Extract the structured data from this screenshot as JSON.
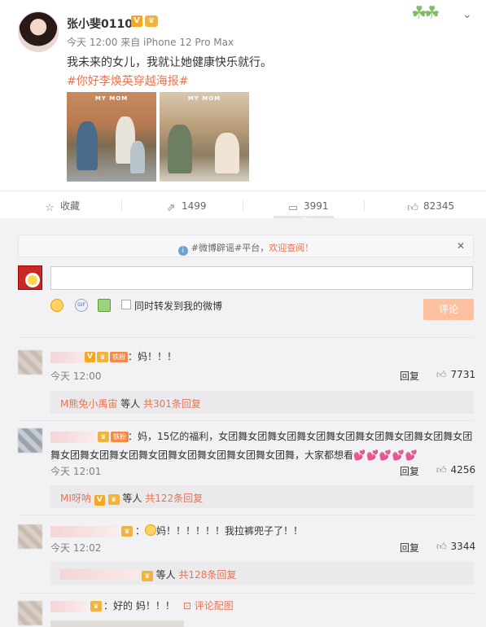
{
  "post": {
    "username": "张小斐0110",
    "meta": "今天 12:00 来自 iPhone 12 Pro Max",
    "text": "我未来的女儿，我就让她健康快乐就行。",
    "topic": "#你好李焕英穿越海报#",
    "image_labels": [
      "MY MOM",
      "MY MOM"
    ]
  },
  "actions": {
    "favorite": "收藏",
    "repost": "1499",
    "comment": "3991",
    "like": "82345"
  },
  "notice": {
    "prefix": "#微博辟谣#平台，",
    "highlight": "欢迎查阅！"
  },
  "composer": {
    "checkbox_label": "同时转发到我的微博",
    "submit_label": "评论"
  },
  "comments": [
    {
      "text": "：妈！！！",
      "badge": "铁粉",
      "time": "今天 12:00",
      "reply": "回复",
      "likes": "7731",
      "sub_user": "M熊兔小禹宙",
      "sub_mid": " 等人 ",
      "sub_link": "共301条回复"
    },
    {
      "text_line1": "：妈，15亿的福利，女团舞女团舞女团舞女团舞女团舞女团舞女团舞女团舞女团",
      "text_line2": "舞女团舞女团舞女团舞女团舞女团舞女团舞女团舞女团舞，大家都想看",
      "badge": "铁粉",
      "time": "今天 12:01",
      "reply": "回复",
      "likes": "4256",
      "sub_user": "MI呀呐",
      "sub_mid": " 等人 ",
      "sub_link": "共122条回复"
    },
    {
      "text": "妈！！！！！！我拉裤兜子了！！",
      "time": "今天 12:02",
      "reply": "回复",
      "likes": "3344",
      "sub_mid": " 等人 ",
      "sub_link": "共128条回复"
    },
    {
      "text": "：好的 妈！！！",
      "pic_link": "评论配图"
    }
  ]
}
